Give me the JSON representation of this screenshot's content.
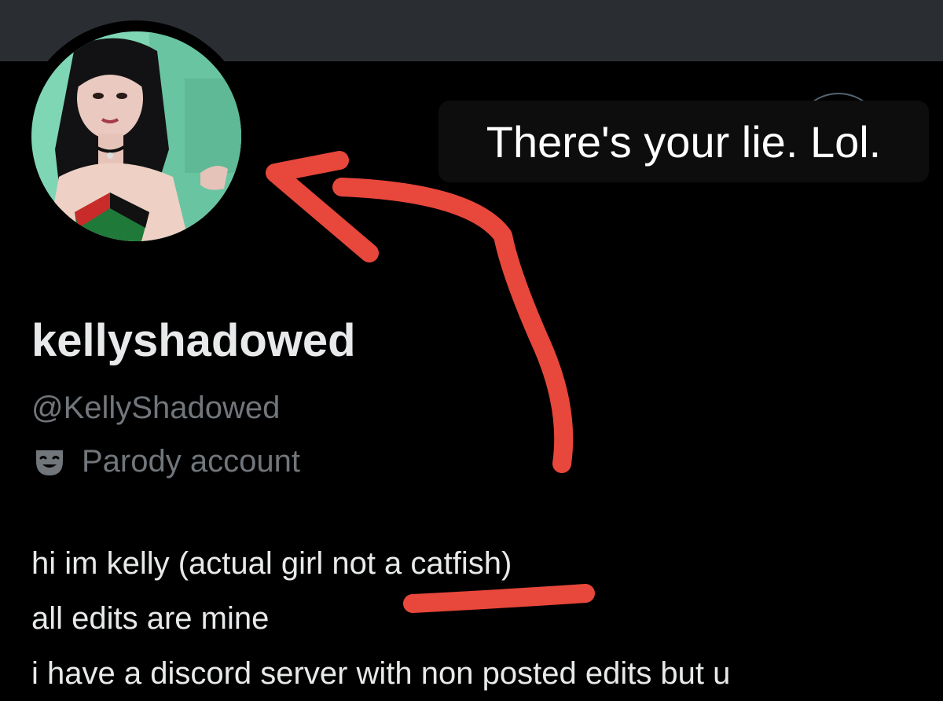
{
  "profile": {
    "display_name": "kellyshadowed",
    "handle": "@KellyShadowed",
    "label_icon": "theater-mask-icon",
    "label": "Parody account",
    "bio_lines": [
      "hi im kelly (actual girl not a catfish)",
      "all edits are mine",
      "i have a discord server with non posted edits but u"
    ]
  },
  "annotation": {
    "caption": "There's your lie. Lol.",
    "arrow_color": "#e8473b",
    "underline_color": "#e8473b"
  },
  "colors": {
    "banner": "#2a2e33",
    "background": "#000000",
    "primary_text": "#e7e9ea",
    "secondary_text": "#71767b"
  }
}
